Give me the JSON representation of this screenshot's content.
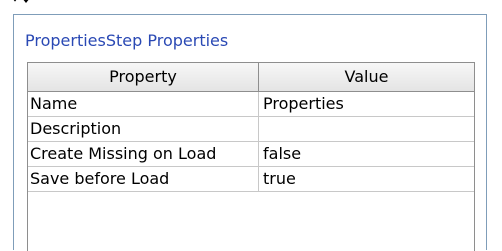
{
  "panel": {
    "title": "PropertiesStep Properties"
  },
  "table": {
    "columns": [
      "Property",
      "Value"
    ],
    "rows": [
      {
        "property": "Name",
        "value": "Properties"
      },
      {
        "property": "Description",
        "value": ""
      },
      {
        "property": "Create Missing on Load",
        "value": "false"
      },
      {
        "property": "Save before Load",
        "value": "true"
      }
    ]
  },
  "icons": {
    "top_left": "collapse-arrow-icon"
  },
  "colors": {
    "title": "#2a49b4",
    "panel_border": "#7f9db9",
    "grid_border": "#8e8e8e"
  }
}
